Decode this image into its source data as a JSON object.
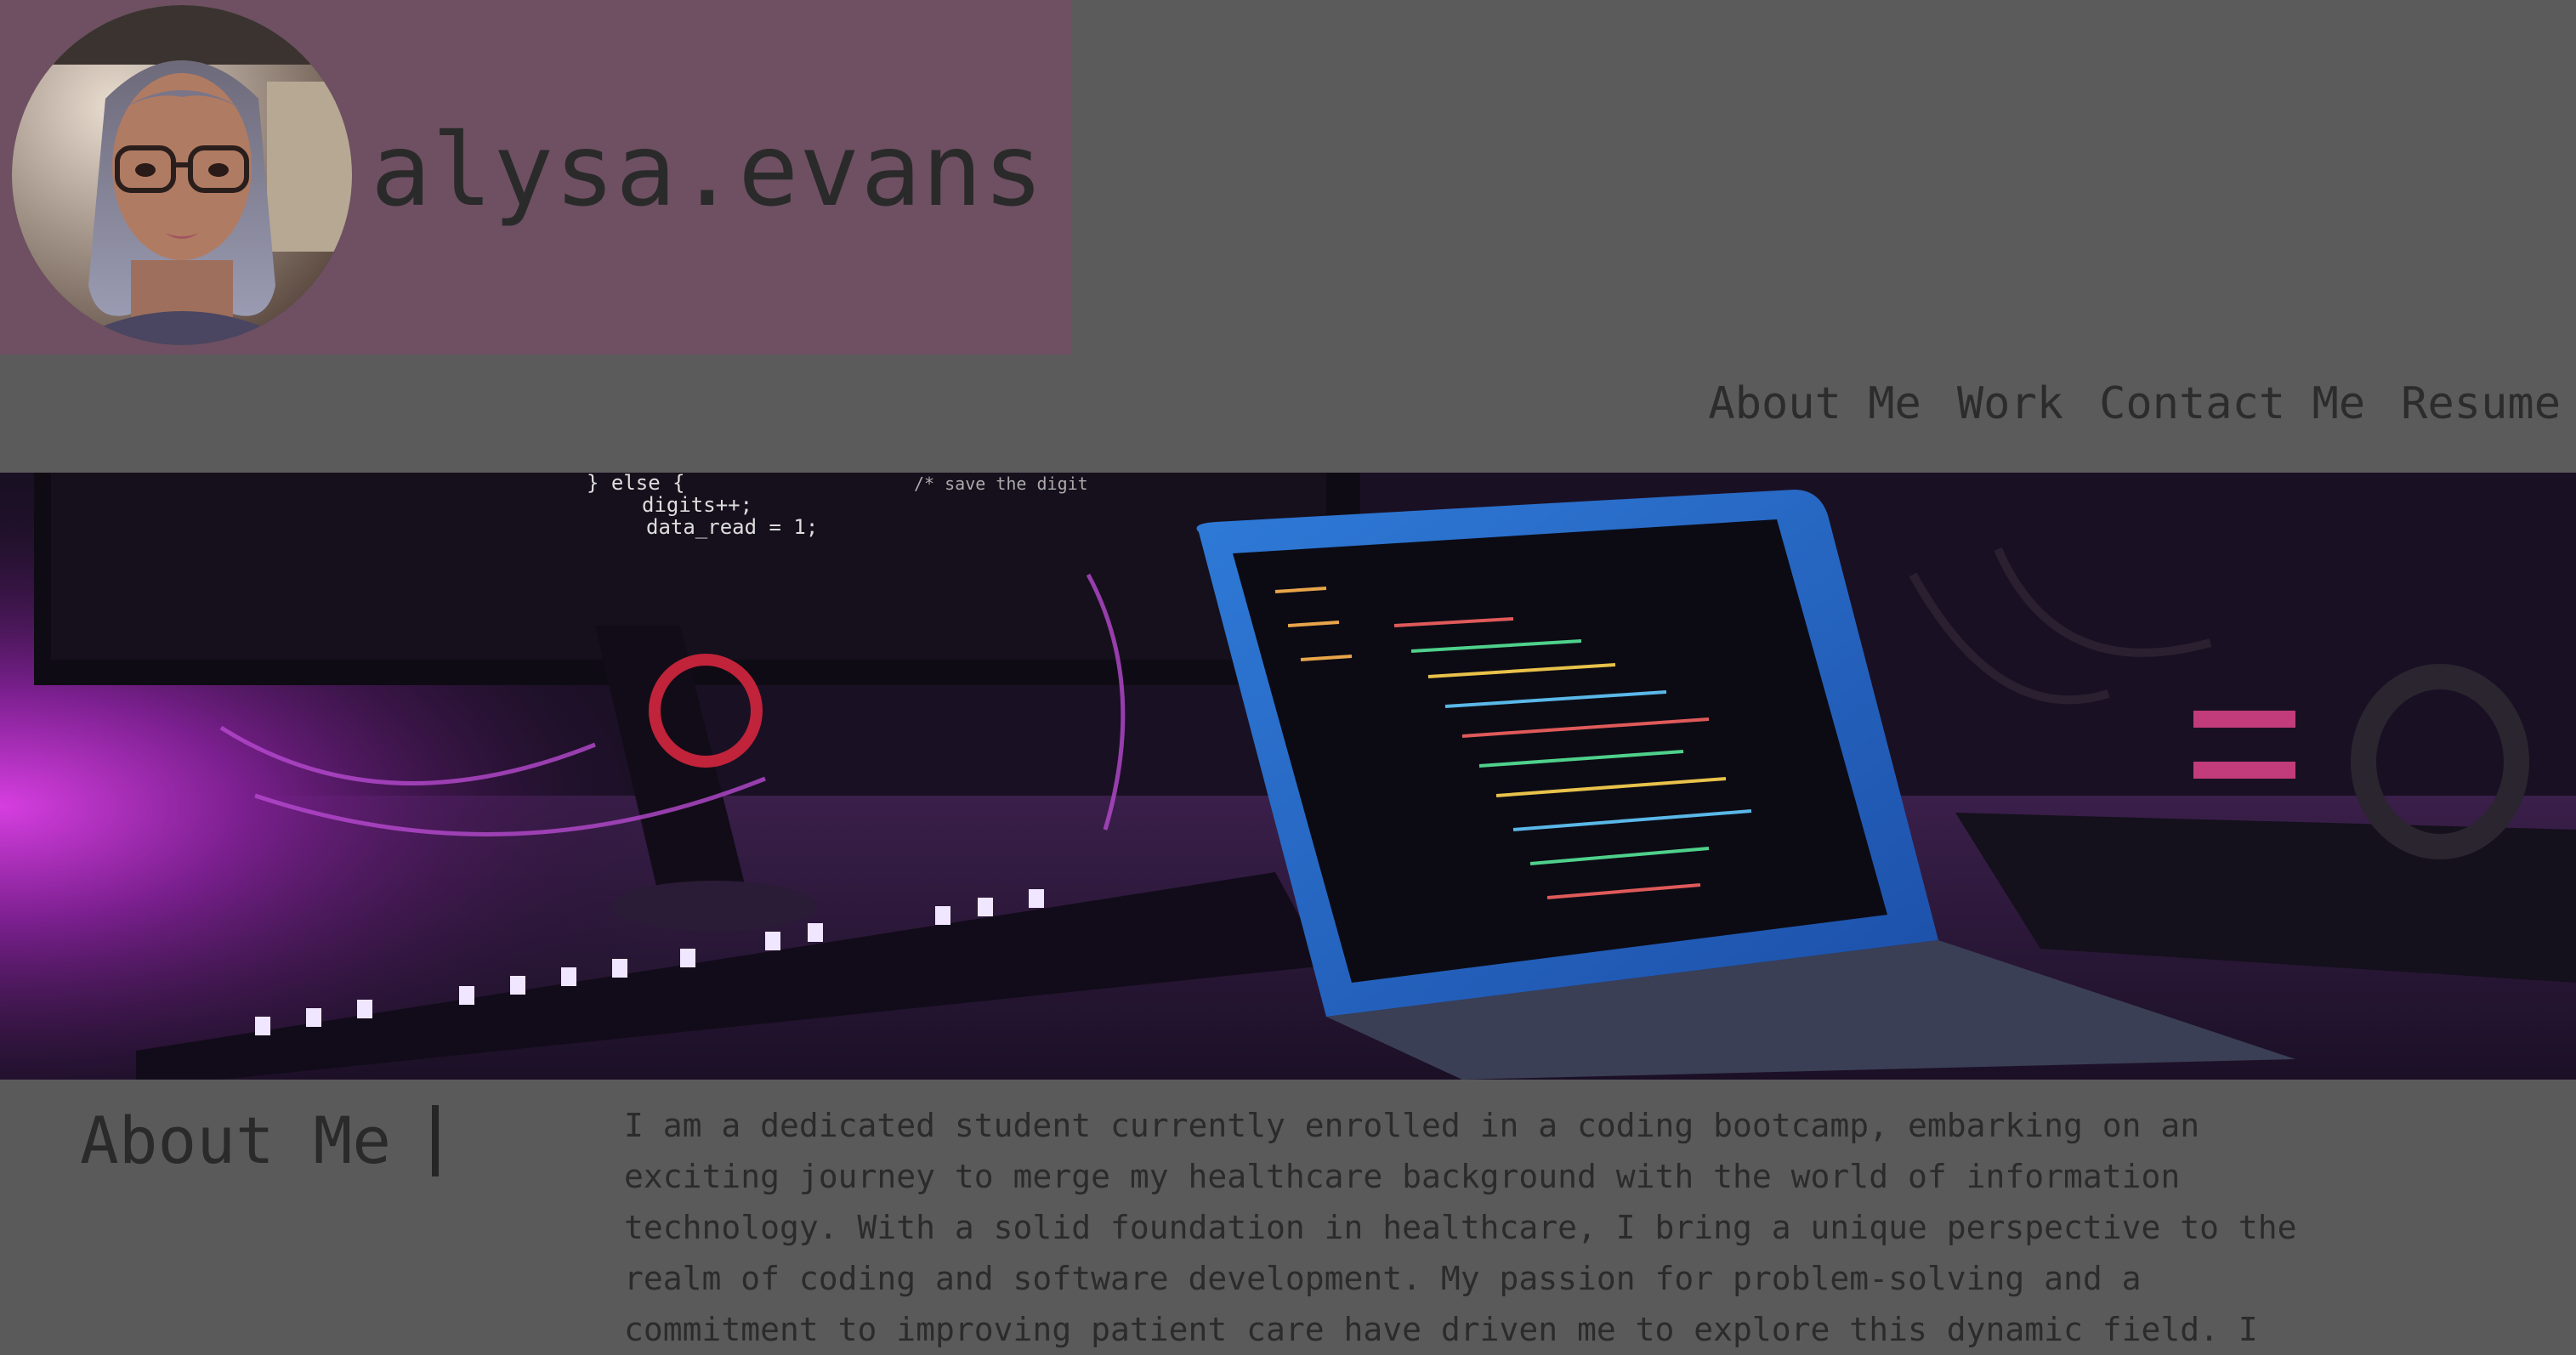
{
  "brand": {
    "name": "alysa.evans",
    "accent_color": "#6e5062",
    "avatar": "profile-photo"
  },
  "nav": {
    "items": [
      {
        "label": "About Me"
      },
      {
        "label": "Work"
      },
      {
        "label": "Contact Me"
      },
      {
        "label": "Resume"
      }
    ]
  },
  "hero": {
    "image": "coding-desk-laptop-photo",
    "code_lines": [
      "} else {",
      "digits++;",
      "data_read = 1;",
      "/* save the digit"
    ]
  },
  "about": {
    "title": "About Me",
    "text": "I am a dedicated student currently enrolled in a coding bootcamp, embarking on an exciting journey to merge my healthcare background with the world of information technology. With a solid foundation in healthcare, I bring a unique perspective to the realm of coding and software development. My passion for problem-solving and a commitment to improving patient care have driven me to explore this dynamic field. I"
  }
}
